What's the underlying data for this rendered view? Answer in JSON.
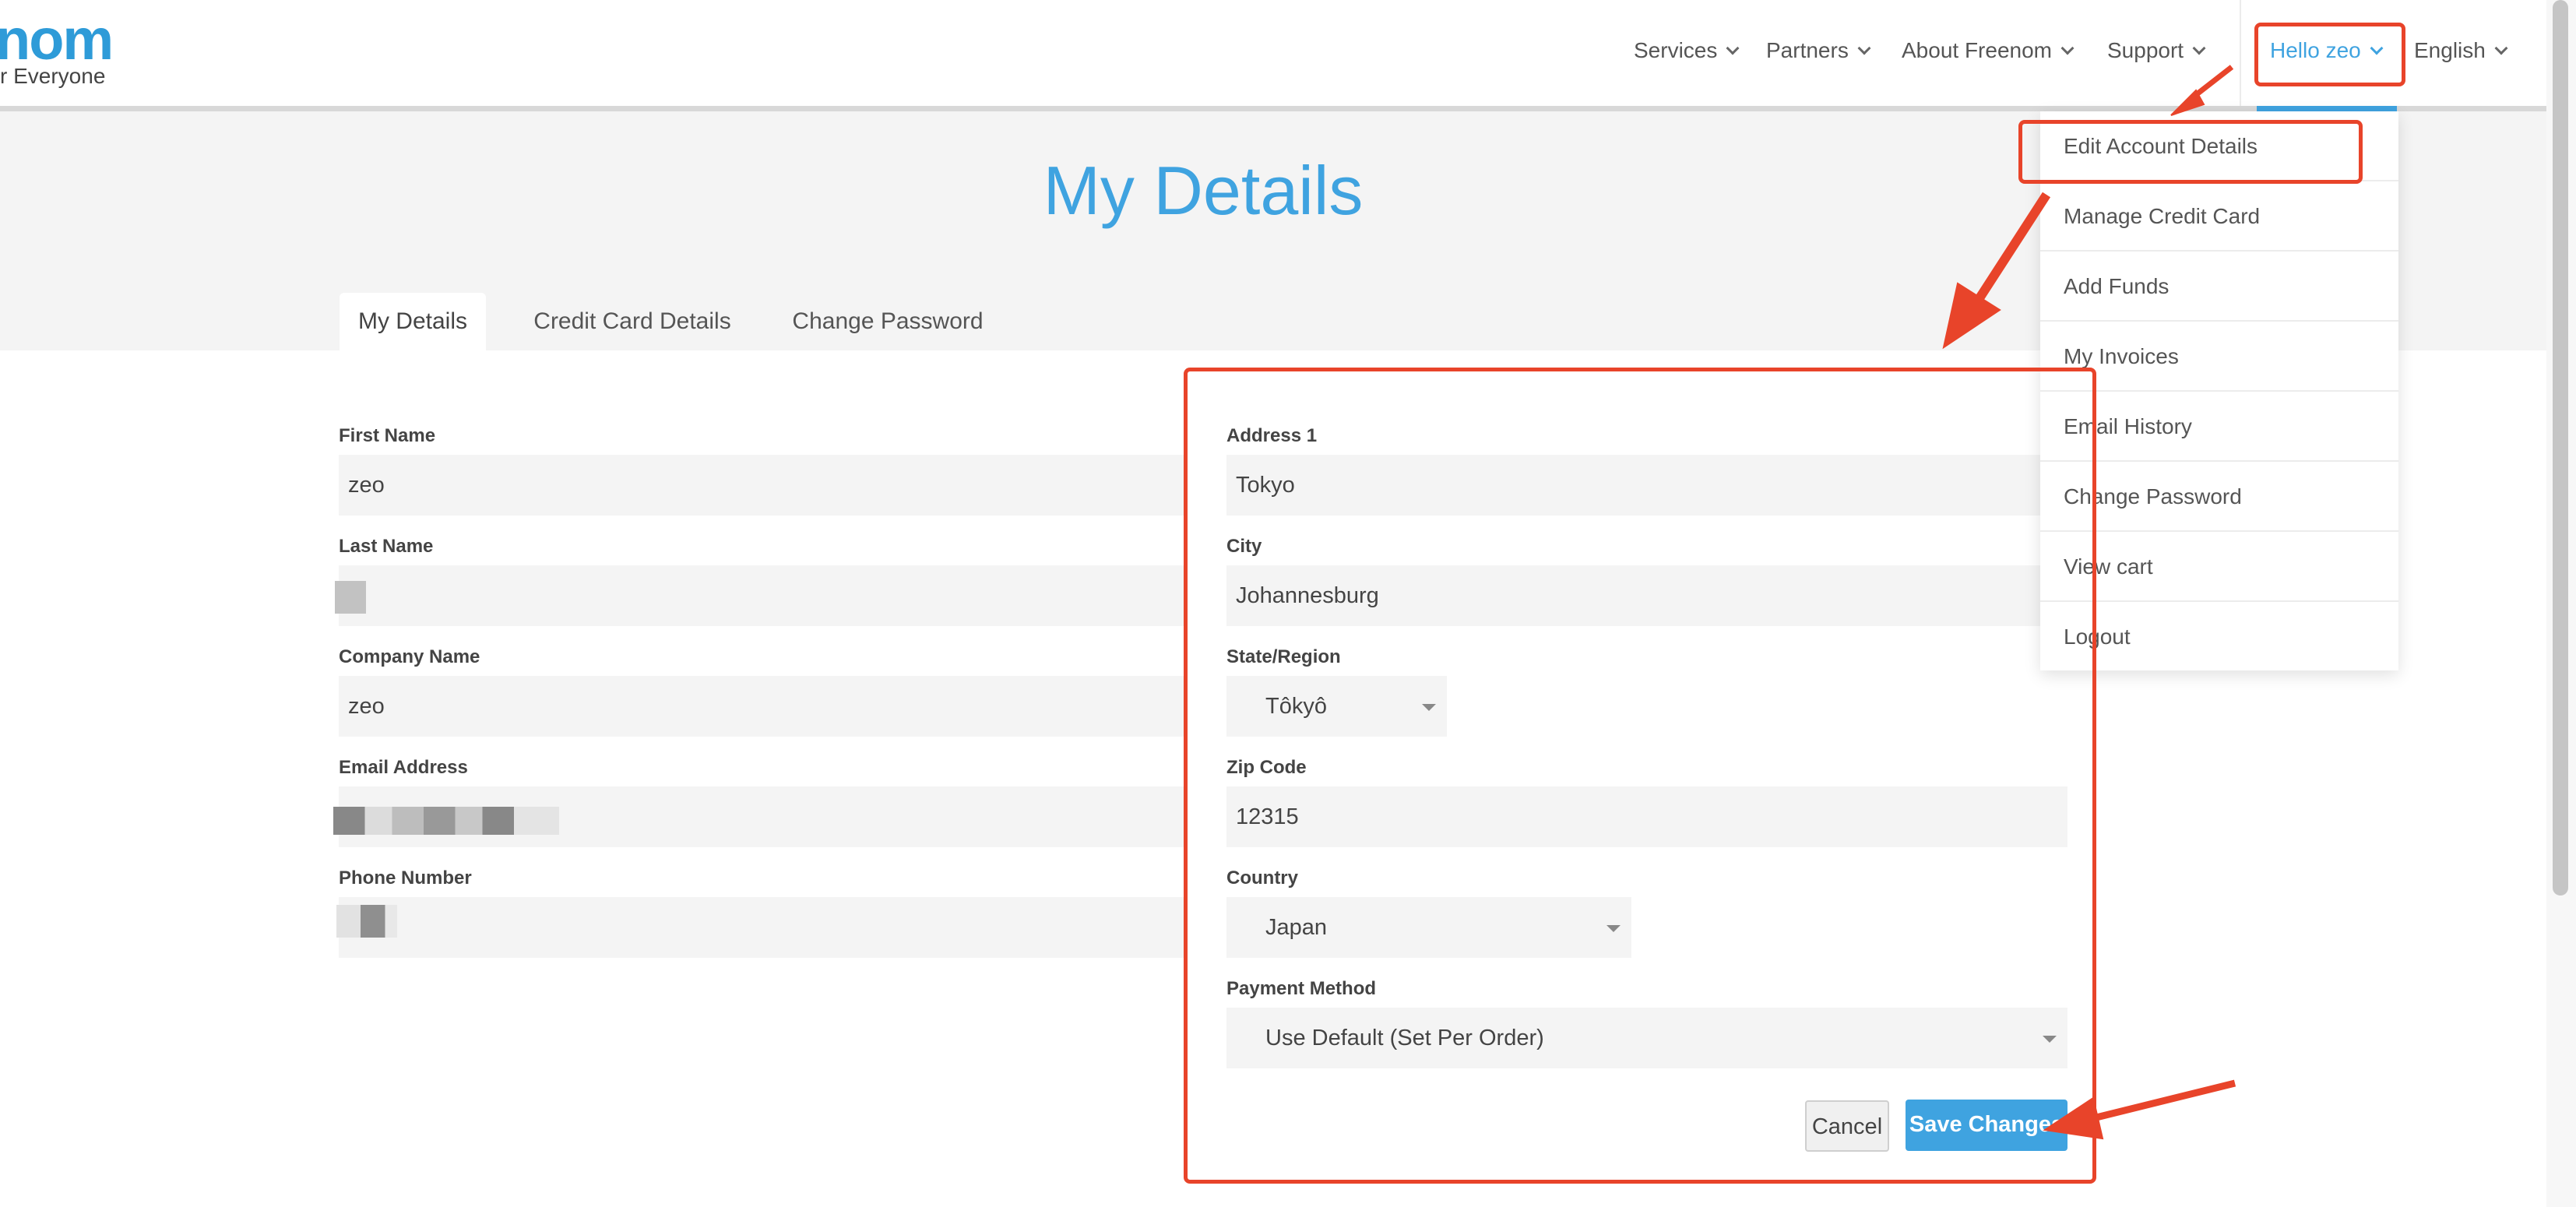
{
  "brand": {
    "logo_text": "nom",
    "tagline": "r Everyone"
  },
  "nav": {
    "items": [
      {
        "label": "Services"
      },
      {
        "label": "Partners"
      },
      {
        "label": "About Freenom"
      },
      {
        "label": "Support"
      }
    ],
    "user": {
      "label": "Hello zeo"
    },
    "language": {
      "label": "English"
    }
  },
  "account_menu": {
    "items": [
      {
        "label": "Edit Account Details"
      },
      {
        "label": "Manage Credit Card"
      },
      {
        "label": "Add Funds"
      },
      {
        "label": "My Invoices"
      },
      {
        "label": "Email History"
      },
      {
        "label": "Change Password"
      },
      {
        "label": "View cart"
      },
      {
        "label": "Logout"
      }
    ]
  },
  "page": {
    "title": "My Details",
    "tabs": [
      {
        "label": "My Details",
        "active": true
      },
      {
        "label": "Credit Card Details",
        "active": false
      },
      {
        "label": "Change Password",
        "active": false
      }
    ]
  },
  "form": {
    "first_name": {
      "label": "First Name",
      "value": "zeo"
    },
    "last_name": {
      "label": "Last Name",
      "value": ""
    },
    "company_name": {
      "label": "Company Name",
      "value": "zeo"
    },
    "email": {
      "label": "Email Address",
      "value": ""
    },
    "phone": {
      "label": "Phone Number",
      "value": ""
    },
    "address1": {
      "label": "Address 1",
      "value": "Tokyo"
    },
    "city": {
      "label": "City",
      "value": "Johannesburg"
    },
    "state": {
      "label": "State/Region",
      "value": "Tôkyô"
    },
    "zip": {
      "label": "Zip Code",
      "value": "12315"
    },
    "country": {
      "label": "Country",
      "value": "Japan"
    },
    "payment_method": {
      "label": "Payment Method",
      "value": "Use Default (Set Per Order)"
    },
    "cancel_label": "Cancel",
    "save_label": "Save Changes"
  },
  "colors": {
    "accent": "#3fa3e0",
    "annotation": "#e8442a",
    "field_bg": "#f4f4f4"
  }
}
